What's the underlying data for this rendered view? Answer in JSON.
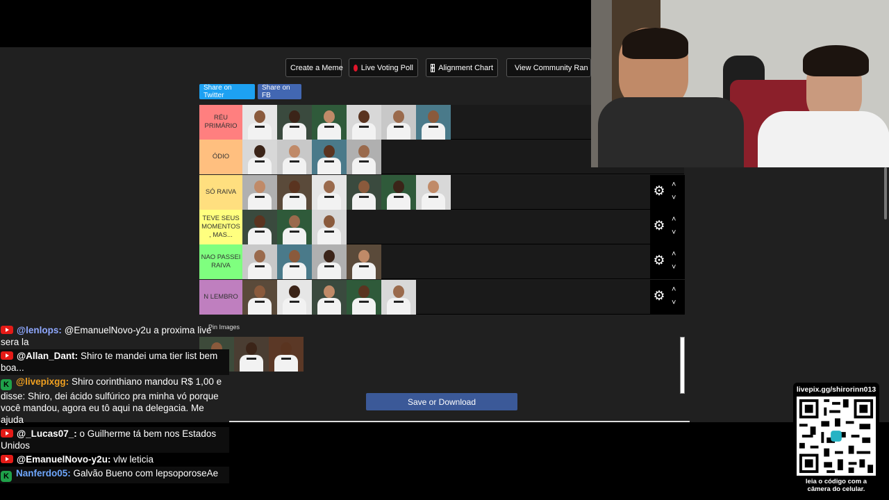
{
  "toolbar": {
    "create_meme": "Create a Meme",
    "live_voting": "Live Voting Poll",
    "alignment_chart": "Alignment Chart",
    "community_rank": "View Community Ran"
  },
  "share": {
    "twitter": "Share on Twitter",
    "facebook": "Share on FB"
  },
  "tiers": [
    {
      "label": "RÉU PRIMÁRIO",
      "color": "#ff7f7f",
      "count": 6,
      "controls": false
    },
    {
      "label": "ÓDIO",
      "color": "#ffbf7f",
      "count": 4,
      "controls": false
    },
    {
      "label": "SÓ RAIVA",
      "color": "#ffdf7f",
      "count": 6,
      "controls": true
    },
    {
      "label": "TEVE SEUS MOMENTOS , MAS...",
      "color": "#ffff7f",
      "count": 3,
      "controls": true
    },
    {
      "label": "NAO PASSEI RAIVA",
      "color": "#7fff7f",
      "count": 4,
      "controls": true
    },
    {
      "label": "N LEMBRO",
      "color": "#bf7fbf",
      "count": 5,
      "controls": true
    }
  ],
  "pin_images_label": "Pin Images",
  "save_download": "Save or Download",
  "qr": {
    "url": "livepix.gg/shirorinn013",
    "caption_1": "leia o código com a",
    "caption_2": "câmera do celular."
  },
  "chat": [
    {
      "platform": "youtube",
      "user": "@lenlops:",
      "user_color": "#8fa8ff",
      "text": "@EmanuelNovo-y2u a proxima live sera la"
    },
    {
      "platform": "youtube",
      "user": "@Allan_Dant:",
      "user_color": "#ffffff",
      "text": "Shiro te mandei uma tier list bem boa..."
    },
    {
      "platform": "livepix",
      "user": "@livepixgg:",
      "user_color": "#f0a020",
      "text": "Shiro corinthiano mandou R$ 1,00 e disse: Shiro, dei ácido sulfúrico pra minha vó porque você mandou, agora eu tô aqui na delegacia. Me ajuda"
    },
    {
      "platform": "youtube",
      "user": "@_Lucas07_:",
      "user_color": "#ffffff",
      "text": "o Guilherme tá bem nos Estados Unidos"
    },
    {
      "platform": "youtube",
      "user": "@EmanuelNovo-y2u:",
      "user_color": "#ffffff",
      "text": "vlw leticia"
    },
    {
      "platform": "livepix",
      "user": "Nanferdo05:",
      "user_color": "#6fa8ff",
      "text": "Galvão Bueno com lepsoporoseAe"
    }
  ]
}
